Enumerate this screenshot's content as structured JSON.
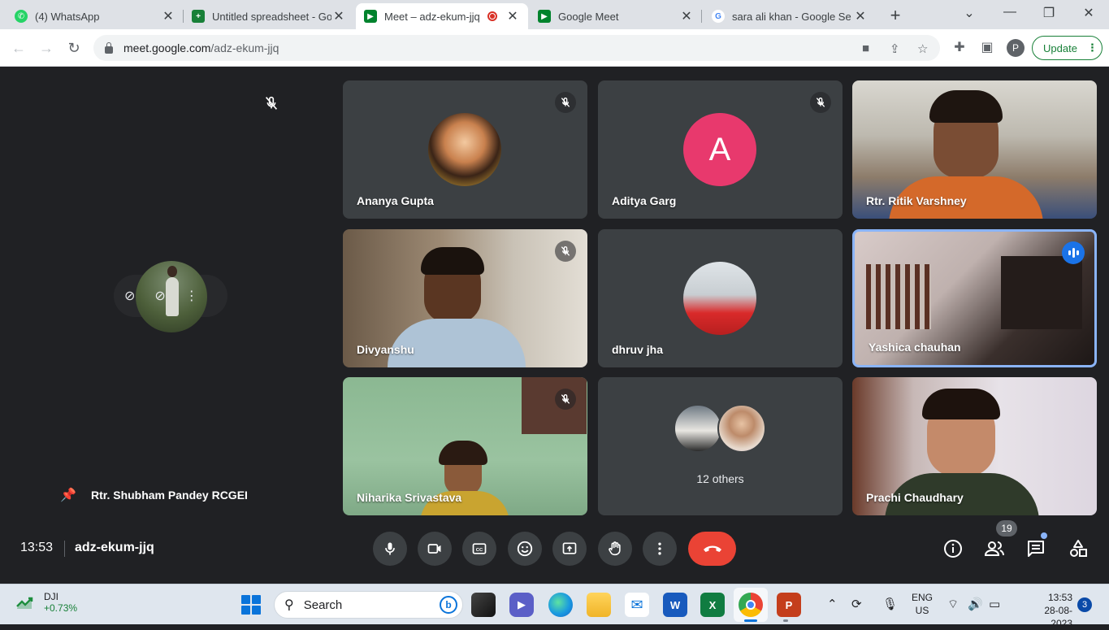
{
  "browser": {
    "tabs": [
      {
        "label": "(4) WhatsApp",
        "icon": "whatsapp-icon",
        "color": "#25d366"
      },
      {
        "label": "Untitled spreadsheet - Go",
        "icon": "sheets-icon",
        "color": "#188038"
      },
      {
        "label": "Meet – adz-ekum-jjq",
        "icon": "meet-icon",
        "color": "#00832d",
        "active": true
      },
      {
        "label": "Google Meet",
        "icon": "meet-icon",
        "color": "#00832d"
      },
      {
        "label": "sara ali khan - Google Se",
        "icon": "google-icon",
        "color": "#4285f4"
      }
    ],
    "url_host": "meet.google.com",
    "url_path": "/adz-ekum-jjq",
    "update_label": "Update",
    "profile_initial": "P"
  },
  "meet": {
    "pinned": {
      "name": "Rtr. Shubham Pandey RCGEI"
    },
    "tiles": [
      {
        "name": "Ananya Gupta",
        "muted": true
      },
      {
        "name": "Aditya Garg",
        "muted": true,
        "initial": "A"
      },
      {
        "name": "Rtr. Ritik Varshney",
        "muted": false
      },
      {
        "name": "Divyanshu",
        "muted": true
      },
      {
        "name": "dhruv jha",
        "muted": false
      },
      {
        "name": "Yashica chauhan",
        "muted": false,
        "speaking": true
      },
      {
        "name": "Niharika Srivastava",
        "muted": true
      },
      {
        "name": "12 others",
        "muted": false
      },
      {
        "name": "Prachi Chaudhary",
        "muted": false
      }
    ],
    "bottom": {
      "time": "13:53",
      "code": "adz-ekum-jjq",
      "people_count": "19",
      "end_call_color": "#ea4335"
    }
  },
  "taskbar": {
    "widget_name": "DJI",
    "widget_value": "+0.73%",
    "search_label": "Search",
    "lang_line1": "ENG",
    "lang_line2": "US",
    "time": "13:53",
    "date": "28-08-2023",
    "notifications": "3"
  }
}
